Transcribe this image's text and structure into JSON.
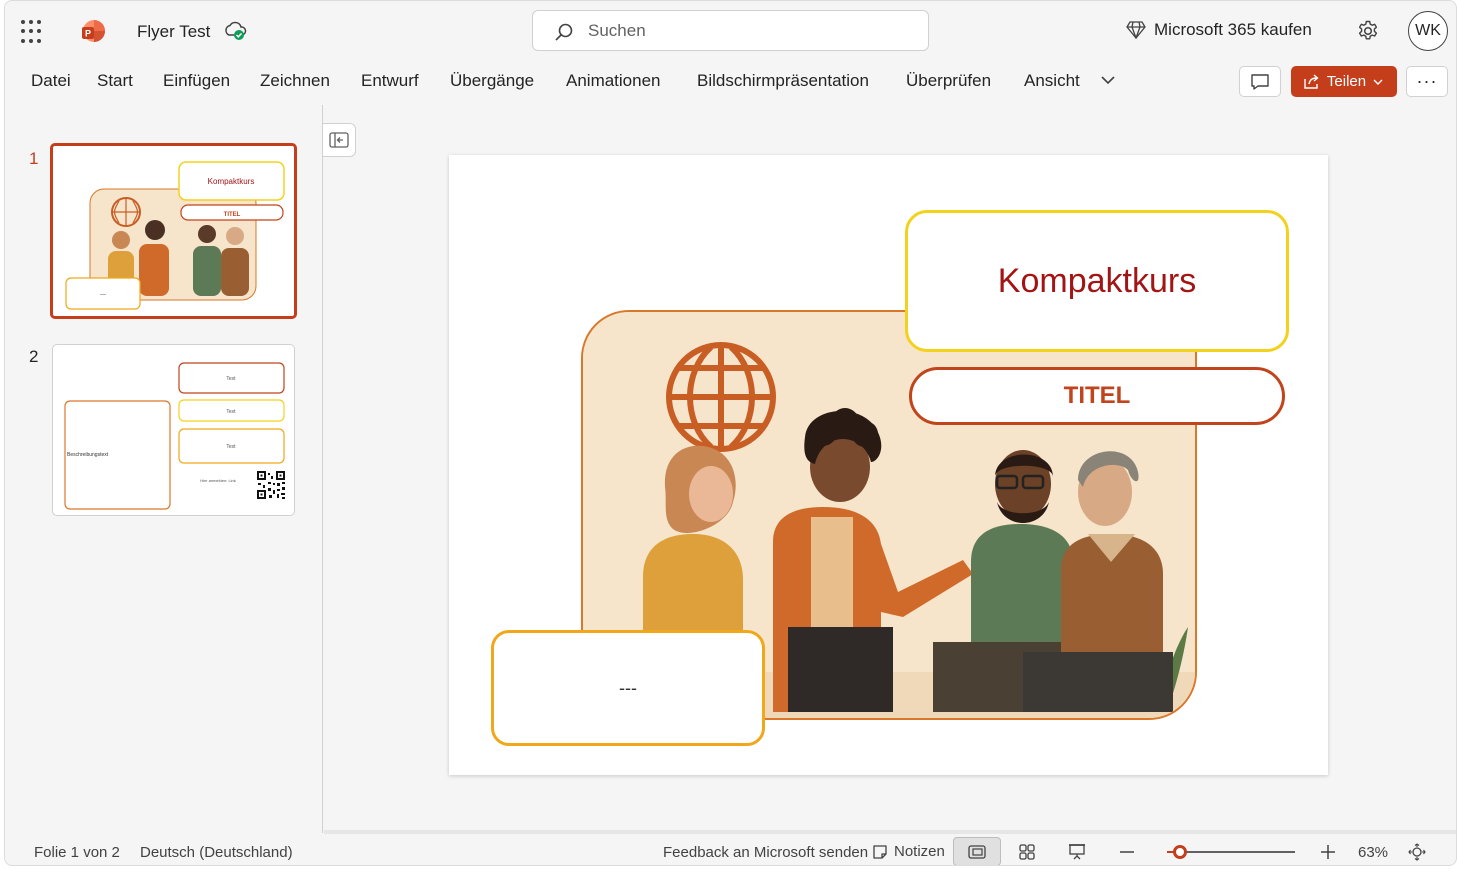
{
  "app": {
    "doc_title": "Flyer Test",
    "search_placeholder": "Suchen",
    "buy_label": "Microsoft 365 kaufen",
    "avatar_initials": "WK",
    "accent_color": "#c43e1c"
  },
  "ribbon": {
    "tabs": [
      "Datei",
      "Start",
      "Einfügen",
      "Zeichnen",
      "Entwurf",
      "Übergänge",
      "Animationen",
      "Bildschirmpräsentation",
      "Überprüfen",
      "Ansicht"
    ],
    "share_label": "Teilen"
  },
  "thumbnails": [
    {
      "number": "1",
      "title": "Kompaktkurs",
      "subtitle": "TITEL",
      "box": "---"
    },
    {
      "number": "2",
      "box1": "Text",
      "box2": "Text",
      "box3": "Text",
      "description": "Beschreibungstext",
      "register_text": "Hier anmelden: Link"
    }
  ],
  "slide": {
    "title": "Kompaktkurs",
    "subtitle": "TITEL",
    "placeholder": "---"
  },
  "status": {
    "slide_info": "Folie 1 von 2",
    "language": "Deutsch (Deutschland)",
    "feedback": "Feedback an Microsoft senden",
    "notes": "Notizen",
    "zoom": "63%"
  },
  "icons": [
    "app-launcher-icon",
    "powerpoint-logo-icon",
    "cloud-saved-icon",
    "search-icon",
    "diamond-icon",
    "gear-icon",
    "chevron-down-icon",
    "comment-icon",
    "share-icon",
    "more-icon",
    "collapse-panel-icon",
    "notes-icon",
    "normal-view-icon",
    "sorter-view-icon",
    "presenter-view-icon",
    "zoom-out-icon",
    "zoom-in-icon",
    "fit-slide-icon",
    "globe-icon"
  ]
}
